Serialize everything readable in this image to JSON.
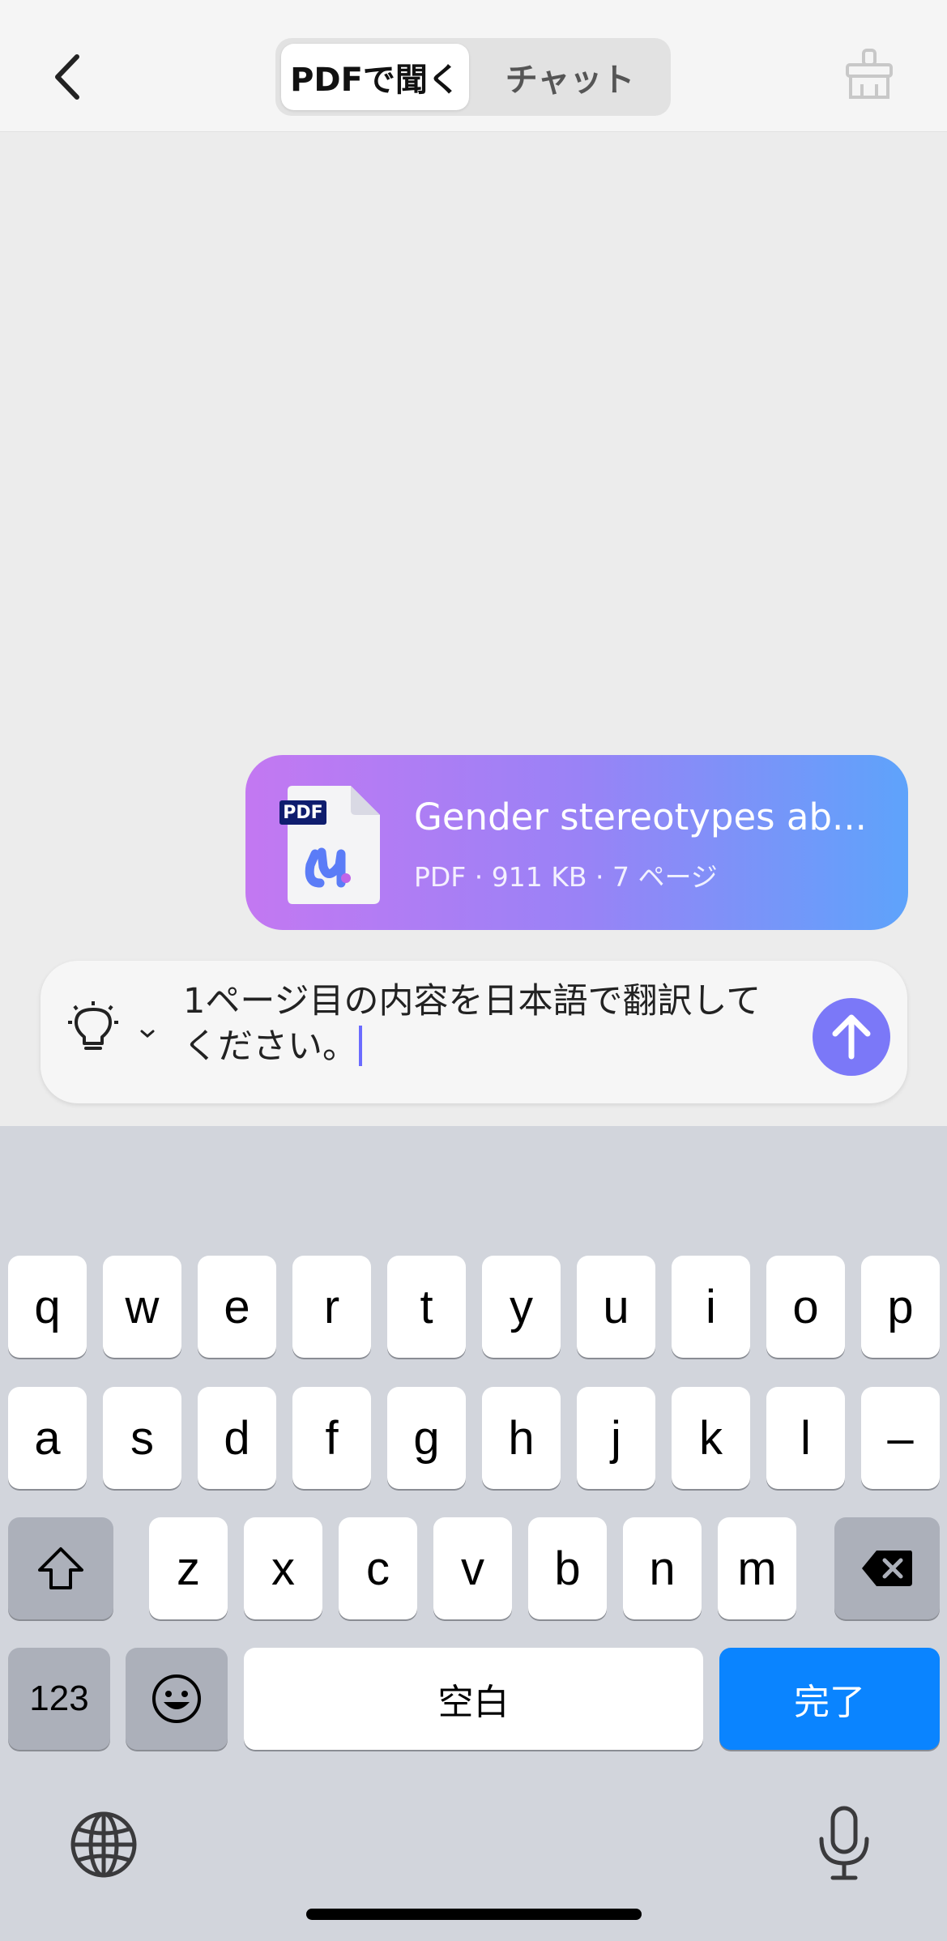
{
  "header": {
    "tabs": [
      {
        "label": "PDFで聞く",
        "active": true
      },
      {
        "label": "チャット",
        "active": false
      }
    ],
    "back_icon": "chevron-left-icon",
    "clear_icon": "broom-icon"
  },
  "file_card": {
    "badge": "PDF",
    "name": "Gender stereotypes ab...",
    "meta": "PDF · 911 KB · 7 ページ",
    "gradient": [
      "#c378f2",
      "#9a82f6",
      "#5ea3fb"
    ]
  },
  "input": {
    "text": "1ページ目の内容を日本語で翻訳して\nください。",
    "send_color": "#7b78f8",
    "bulb_icon": "lightbulb-icon"
  },
  "keyboard": {
    "row1": [
      "q",
      "w",
      "e",
      "r",
      "t",
      "y",
      "u",
      "i",
      "o",
      "p"
    ],
    "row2": [
      "a",
      "s",
      "d",
      "f",
      "g",
      "h",
      "j",
      "k",
      "l",
      "–"
    ],
    "row3": [
      "z",
      "x",
      "c",
      "v",
      "b",
      "n",
      "m"
    ],
    "num_label": "123",
    "space_label": "空白",
    "done_label": "完了",
    "accent": "#0a84ff"
  }
}
